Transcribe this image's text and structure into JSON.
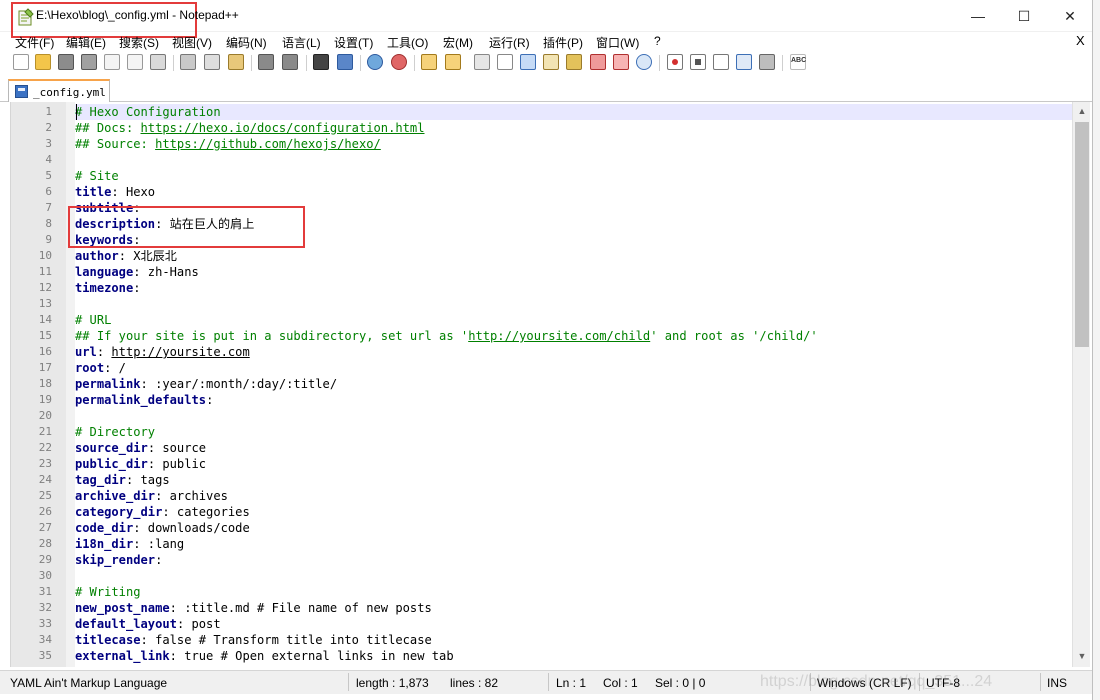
{
  "window": {
    "title": "E:\\Hexo\\blog\\_config.yml - Notepad++",
    "minimize": "—",
    "maximize": "☐",
    "close": "✕"
  },
  "menu": {
    "items": [
      "文件(F)",
      "编辑(E)",
      "搜索(S)",
      "视图(V)",
      "编码(N)",
      "语言(L)",
      "设置(T)",
      "工具(O)",
      "宏(M)",
      "运行(R)",
      "插件(P)",
      "窗口(W)",
      "?"
    ],
    "close_label": "X"
  },
  "tab": {
    "label": "_config.yml"
  },
  "editor": {
    "lines": [
      {
        "n": "1",
        "parts": [
          {
            "t": "# Hexo Configuration",
            "c": "cmt"
          }
        ]
      },
      {
        "n": "2",
        "parts": [
          {
            "t": "## Docs: ",
            "c": "cmt"
          },
          {
            "t": "https://hexo.io/docs/configuration.html",
            "c": "link"
          }
        ]
      },
      {
        "n": "3",
        "parts": [
          {
            "t": "## Source: ",
            "c": "cmt"
          },
          {
            "t": "https://github.com/hexojs/hexo/",
            "c": "link"
          }
        ]
      },
      {
        "n": "4",
        "parts": []
      },
      {
        "n": "5",
        "parts": [
          {
            "t": "# Site",
            "c": "cmt"
          }
        ]
      },
      {
        "n": "6",
        "parts": [
          {
            "t": "title",
            "c": "key"
          },
          {
            "t": ": Hexo",
            "c": "val"
          }
        ]
      },
      {
        "n": "7",
        "parts": [
          {
            "t": "subtitle",
            "c": "key"
          },
          {
            "t": ":",
            "c": "val"
          }
        ]
      },
      {
        "n": "8",
        "parts": [
          {
            "t": "description",
            "c": "key"
          },
          {
            "t": ": 站在巨人的肩上",
            "c": "val"
          }
        ]
      },
      {
        "n": "9",
        "parts": [
          {
            "t": "keywords",
            "c": "key"
          },
          {
            "t": ":",
            "c": "val"
          }
        ]
      },
      {
        "n": "10",
        "parts": [
          {
            "t": "author",
            "c": "key"
          },
          {
            "t": ": X北辰北",
            "c": "val"
          }
        ]
      },
      {
        "n": "11",
        "parts": [
          {
            "t": "language",
            "c": "key"
          },
          {
            "t": ": zh-Hans",
            "c": "val"
          }
        ]
      },
      {
        "n": "12",
        "parts": [
          {
            "t": "timezone",
            "c": "key"
          },
          {
            "t": ":",
            "c": "val"
          }
        ]
      },
      {
        "n": "13",
        "parts": []
      },
      {
        "n": "14",
        "parts": [
          {
            "t": "# URL",
            "c": "cmt"
          }
        ]
      },
      {
        "n": "15",
        "parts": [
          {
            "t": "## If your site is put in a subdirectory, set url as '",
            "c": "cmt"
          },
          {
            "t": "http://yoursite.com/child",
            "c": "link"
          },
          {
            "t": "' and root as '/child/'",
            "c": "cmt"
          }
        ]
      },
      {
        "n": "16",
        "parts": [
          {
            "t": "url",
            "c": "key"
          },
          {
            "t": ": ",
            "c": "val"
          },
          {
            "t": "http://yoursite.com",
            "c": "link-black"
          }
        ]
      },
      {
        "n": "17",
        "parts": [
          {
            "t": "root",
            "c": "key"
          },
          {
            "t": ": /",
            "c": "val"
          }
        ]
      },
      {
        "n": "18",
        "parts": [
          {
            "t": "permalink",
            "c": "key"
          },
          {
            "t": ": :year/:month/:day/:title/",
            "c": "val"
          }
        ]
      },
      {
        "n": "19",
        "parts": [
          {
            "t": "permalink_defaults",
            "c": "key"
          },
          {
            "t": ":",
            "c": "val"
          }
        ]
      },
      {
        "n": "20",
        "parts": []
      },
      {
        "n": "21",
        "parts": [
          {
            "t": "# Directory",
            "c": "cmt"
          }
        ]
      },
      {
        "n": "22",
        "parts": [
          {
            "t": "source_dir",
            "c": "key"
          },
          {
            "t": ": source",
            "c": "val"
          }
        ]
      },
      {
        "n": "23",
        "parts": [
          {
            "t": "public_dir",
            "c": "key"
          },
          {
            "t": ": public",
            "c": "val"
          }
        ]
      },
      {
        "n": "24",
        "parts": [
          {
            "t": "tag_dir",
            "c": "key"
          },
          {
            "t": ": tags",
            "c": "val"
          }
        ]
      },
      {
        "n": "25",
        "parts": [
          {
            "t": "archive_dir",
            "c": "key"
          },
          {
            "t": ": archives",
            "c": "val"
          }
        ]
      },
      {
        "n": "26",
        "parts": [
          {
            "t": "category_dir",
            "c": "key"
          },
          {
            "t": ": categories",
            "c": "val"
          }
        ]
      },
      {
        "n": "27",
        "parts": [
          {
            "t": "code_dir",
            "c": "key"
          },
          {
            "t": ": downloads/code",
            "c": "val"
          }
        ]
      },
      {
        "n": "28",
        "parts": [
          {
            "t": "i18n_dir",
            "c": "key"
          },
          {
            "t": ": :lang",
            "c": "val"
          }
        ]
      },
      {
        "n": "29",
        "parts": [
          {
            "t": "skip_render",
            "c": "key"
          },
          {
            "t": ":",
            "c": "val"
          }
        ]
      },
      {
        "n": "30",
        "parts": []
      },
      {
        "n": "31",
        "parts": [
          {
            "t": "# Writing",
            "c": "cmt"
          }
        ]
      },
      {
        "n": "32",
        "parts": [
          {
            "t": "new_post_name",
            "c": "key"
          },
          {
            "t": ": :title.md # File name of new posts",
            "c": "val"
          }
        ]
      },
      {
        "n": "33",
        "parts": [
          {
            "t": "default_layout",
            "c": "key"
          },
          {
            "t": ": post",
            "c": "val"
          }
        ]
      },
      {
        "n": "34",
        "parts": [
          {
            "t": "titlecase",
            "c": "key"
          },
          {
            "t": ": false # Transform title into titlecase",
            "c": "val"
          }
        ]
      },
      {
        "n": "35",
        "parts": [
          {
            "t": "external_link",
            "c": "key"
          },
          {
            "t": ": true # Open external links in new tab",
            "c": "val"
          }
        ]
      }
    ]
  },
  "status": {
    "language": "YAML Ain't Markup Language",
    "length": "length : 1,873",
    "lines": "lines : 82",
    "ln": "Ln : 1",
    "col": "Col : 1",
    "sel": "Sel : 0 | 0",
    "eol": "Windows (CR LF)",
    "encoding": "UTF-8",
    "mode": "INS",
    "watermark": "https://blog.csdn.net/qq_351...24"
  },
  "colors": {
    "annotation_red": "#e33b3b",
    "comment_green": "#008000",
    "key_navy": "#000080",
    "current_line": "#e8e8ff"
  }
}
